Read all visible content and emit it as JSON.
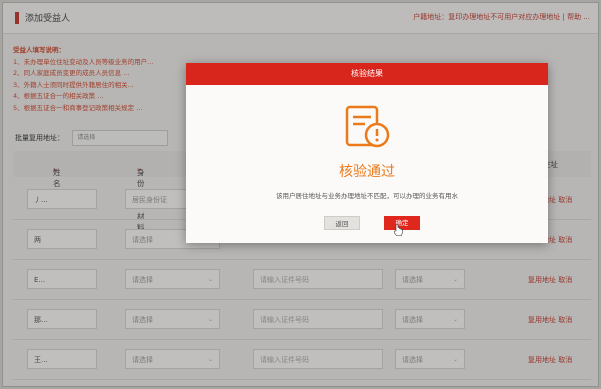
{
  "header": {
    "title": "添加受益人",
    "crumb": "户籍地址：复印办理地址不可用户对应办理地址 | 帮助 ..."
  },
  "notice": {
    "title": "受益人填写说明：",
    "lines": [
      "1、未办理单位住址变动及人员等级业务的用户...",
      "2、同人家庭成员变更的成员人员信息 ...",
      "3、外籍人士须同时提供外籍居住的相关...",
      "4、根据五证合一的相关政策 ...",
      "5、根据五证合一和商事登记政策相关规定 ..."
    ]
  },
  "batch": {
    "label": "批量复用地址：",
    "select_value": "请选择"
  },
  "table": {
    "headers": {
      "name": "姓名",
      "id_type": "身份证明材料",
      "addr": "住址"
    },
    "rows": [
      {
        "name": "丿...",
        "id_type": "居民身份证",
        "id_no": "",
        "sel2": "",
        "ops": "复用地址 取消"
      },
      {
        "name": "两",
        "id_type": "请选择",
        "id_no": "",
        "sel2": "",
        "ops": "复用地址 取消"
      },
      {
        "name": "E...",
        "id_type": "请选择",
        "id_no": "请输入证件号码",
        "sel2": "请选择",
        "ops": "复用地址 取消"
      },
      {
        "name": "那...",
        "id_type": "请选择",
        "id_no": "请输入证件号码",
        "sel2": "请选择",
        "ops": "复用地址 取消"
      },
      {
        "name": "王...",
        "id_type": "请选择",
        "id_no": "请输入证件号码",
        "sel2": "请选择",
        "ops": "复用地址 取消"
      }
    ]
  },
  "modal": {
    "title": "核验结果",
    "status": "核验通过",
    "message": "该用户居住地址与业务办理地址不匹配，可以办理的业务有用水",
    "back_label": "返回",
    "ok_label": "确定"
  }
}
